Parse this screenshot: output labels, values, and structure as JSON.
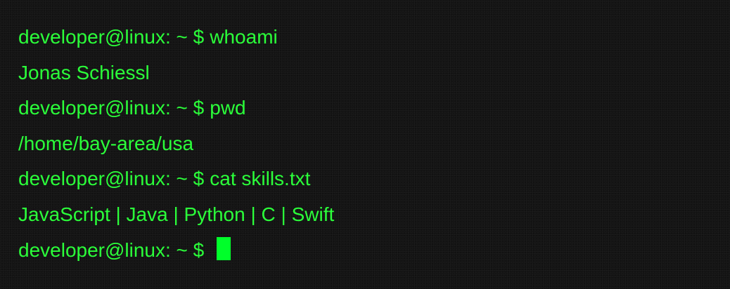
{
  "terminal": {
    "prompt": "developer@linux: ~ $",
    "colors": {
      "background": "#141414",
      "text": "#2bff3a",
      "cursor": "#00ff2a"
    },
    "entries": [
      {
        "command": "whoami",
        "output": "Jonas Schiessl"
      },
      {
        "command": "pwd",
        "output": "/home/bay-area/usa"
      },
      {
        "command": "cat skills.txt",
        "output": "JavaScript | Java | Python | C | Swift"
      }
    ],
    "current_input": ""
  }
}
